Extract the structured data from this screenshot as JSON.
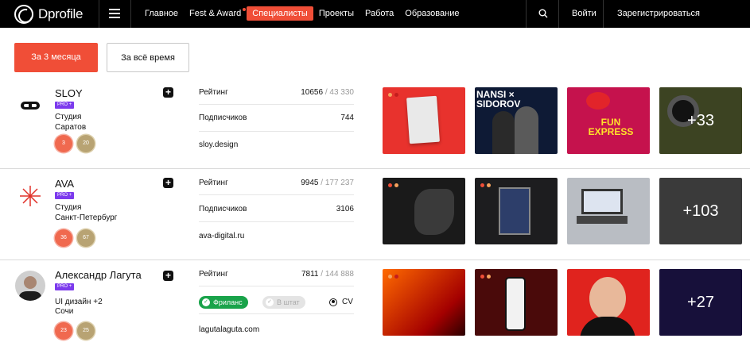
{
  "brand": {
    "name": "Dprofile"
  },
  "nav": {
    "items": [
      {
        "label": "Главное",
        "active": false,
        "dot": false
      },
      {
        "label": "Fest & Award",
        "active": false,
        "dot": true
      },
      {
        "label": "Специалисты",
        "active": true,
        "dot": false
      },
      {
        "label": "Проекты",
        "active": false,
        "dot": false
      },
      {
        "label": "Работа",
        "active": false,
        "dot": false
      },
      {
        "label": "Образование",
        "active": false,
        "dot": false
      }
    ],
    "login": "Войти",
    "register": "Зарегистрироваться"
  },
  "tabs": {
    "primary": "За 3 месяца",
    "secondary": "За всё время"
  },
  "labels": {
    "rating": "Рейтинг",
    "subscribers": "Подписчиков",
    "pro": "PRO +"
  },
  "colors": {
    "accent": "#f04e37",
    "pro": "#7c3aed",
    "freelance": "#19a34a"
  },
  "specialists": [
    {
      "name": "SLOY",
      "info1": "Студия",
      "info2": "Саратов",
      "badges": [
        "3",
        "20"
      ],
      "rating": "10656",
      "rating_total": "/ 43 330",
      "subscribers": "744",
      "site": "sloy.design",
      "more": "+33",
      "thumbs": [
        "red-paper",
        "nansi-sidorov",
        "fun-express",
        "helmet"
      ],
      "thumb_text": {
        "nansi": "NANSI × SIDOROV",
        "fun": "FUN EXPRESS"
      }
    },
    {
      "name": "AVA",
      "info1": "Студия",
      "info2": "Санкт-Петербург",
      "badges": [
        "36",
        "67"
      ],
      "rating": "9945",
      "rating_total": "/ 177 237",
      "subscribers": "3106",
      "site": "ava-digital.ru",
      "more": "+103",
      "thumbs": [
        "dark-abstract",
        "poster-frame",
        "laptop",
        "laptop-grey"
      ]
    },
    {
      "name": "Александр Лагута",
      "info1": "UI дизайн +2",
      "info2": "Сочи",
      "badges": [
        "23",
        "25"
      ],
      "rating": "7811",
      "rating_total": "/ 144 888",
      "status_freelance": "Фриланс",
      "status_staff": "В штат",
      "cv": "CV",
      "site": "lagutalaguta.com",
      "more": "+27",
      "thumbs": [
        "red-portrait",
        "phone-app",
        "smiling-man",
        "dark-boxes"
      ]
    }
  ]
}
